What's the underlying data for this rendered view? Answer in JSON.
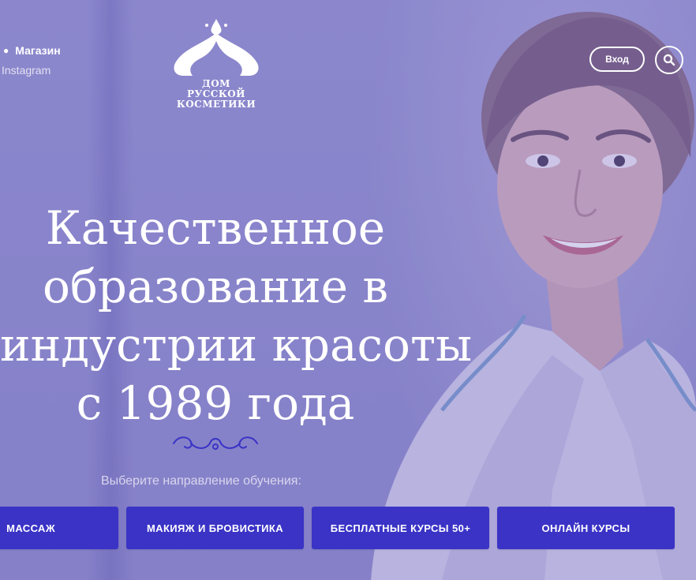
{
  "header": {
    "nav": {
      "shop_label": "Магазин",
      "instagram_label": "Instagram"
    },
    "logo": {
      "lines": [
        "ДОМ",
        "РУССКОЙ",
        "КОСМЕТИКИ"
      ]
    },
    "login_label": "Вход",
    "search_icon": "search-icon"
  },
  "hero": {
    "headline_lines": [
      "Качественное",
      "образование в",
      "индустрии красоты",
      "с 1989 года"
    ],
    "subtitle": "Выберите направление обучения:",
    "courses": [
      {
        "label": "МАССАЖ"
      },
      {
        "label": "МАКИЯЖ И БРОВИСТИКА"
      },
      {
        "label": "БЕСПЛАТНЫЕ КУРСЫ 50+"
      },
      {
        "label": "ОНЛАЙН КУРСЫ"
      }
    ]
  },
  "colors": {
    "overlay": "#8f8cc9",
    "button": "#3a33c6",
    "text": "#ffffff"
  }
}
